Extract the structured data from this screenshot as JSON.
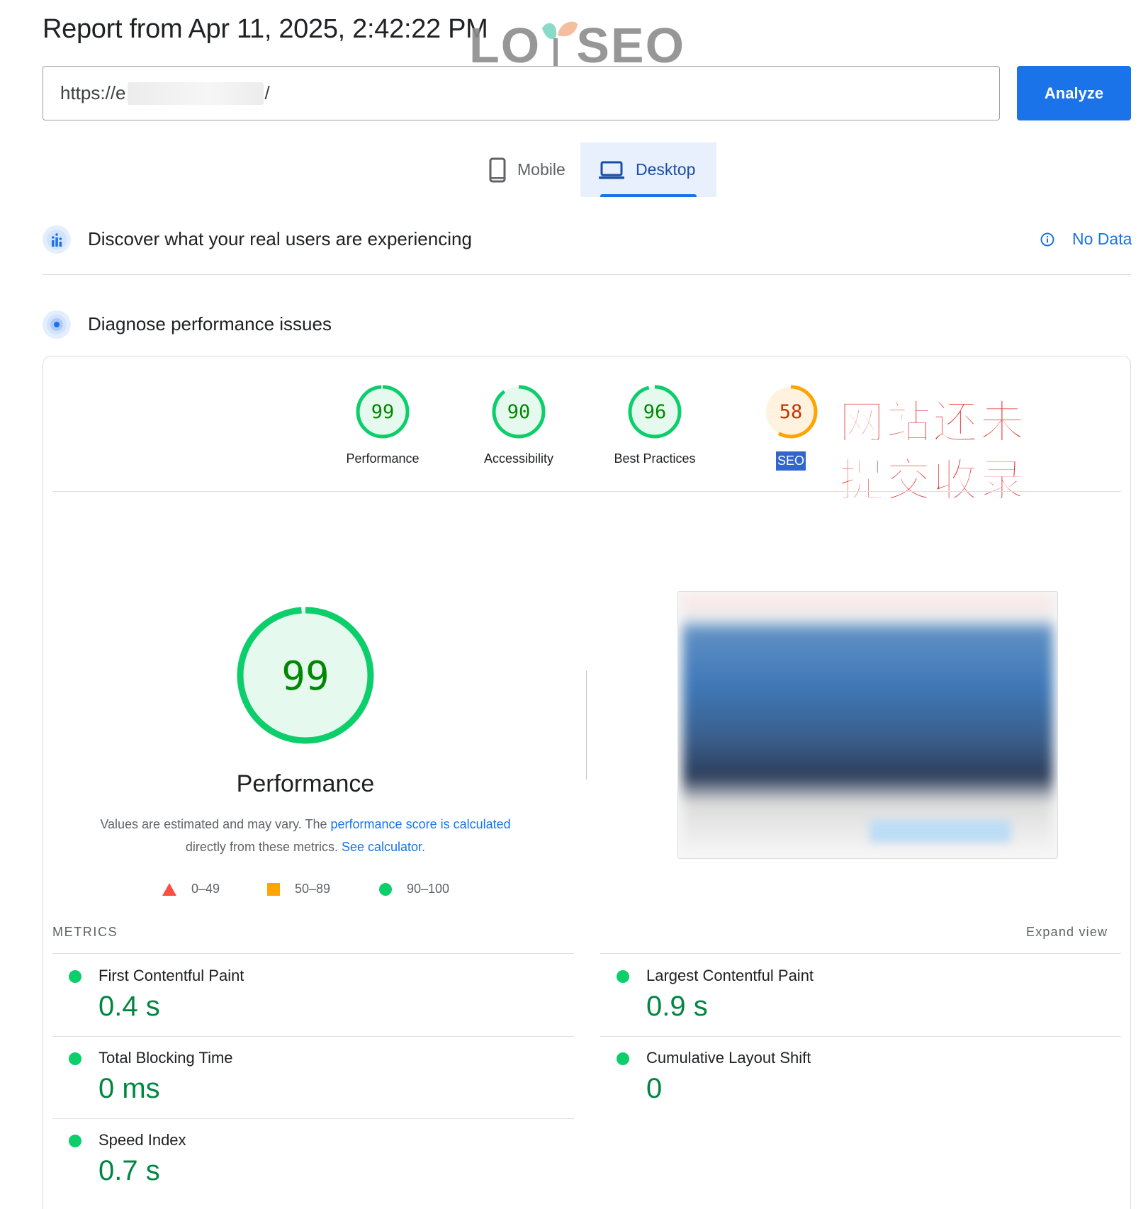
{
  "header": {
    "title": "Report from Apr 11, 2025, 2:42:22 PM",
    "watermark_left": "LO",
    "watermark_right": "SEO"
  },
  "search": {
    "url_prefix": "https://e",
    "url_suffix": "/",
    "analyze_label": "Analyze"
  },
  "tabs": [
    {
      "label": "Mobile",
      "icon": "smartphone-icon",
      "active": false
    },
    {
      "label": "Desktop",
      "icon": "laptop-icon",
      "active": true
    }
  ],
  "real_users": {
    "title": "Discover what your real users are experiencing",
    "status": "No Data",
    "icon": "crux-chart-icon"
  },
  "diagnose": {
    "title": "Diagnose performance issues",
    "icon": "lighthouse-icon"
  },
  "scores": [
    {
      "label": "Performance",
      "value": 99,
      "color": "#0cce6b",
      "text_color": "#008800"
    },
    {
      "label": "Accessibility",
      "value": 90,
      "color": "#0cce6b",
      "text_color": "#008800"
    },
    {
      "label": "Best Practices",
      "value": 96,
      "color": "#0cce6b",
      "text_color": "#008800"
    },
    {
      "label": "SEO",
      "value": 58,
      "color": "#ffa400",
      "text_color": "#c33300"
    }
  ],
  "annotation": {
    "line1": "网站还未",
    "line2": "提交收录"
  },
  "performance": {
    "score": 99,
    "title": "Performance",
    "desc_prefix": "Values are estimated and may vary. The ",
    "desc_link1": "performance score is calculated",
    "desc_middle": "directly from these metrics. ",
    "desc_link2": "See calculator."
  },
  "legend": [
    {
      "range": "0–49",
      "shape": "triangle",
      "color": "#ff4e42"
    },
    {
      "range": "50–89",
      "shape": "square",
      "color": "#ffa400"
    },
    {
      "range": "90–100",
      "shape": "circle",
      "color": "#0cce6b"
    }
  ],
  "metrics": {
    "heading": "METRICS",
    "expand_label": "Expand view",
    "items": [
      {
        "name": "First Contentful Paint",
        "value": "0.4 s"
      },
      {
        "name": "Largest Contentful Paint",
        "value": "0.9 s"
      },
      {
        "name": "Total Blocking Time",
        "value": "0 ms"
      },
      {
        "name": "Cumulative Layout Shift",
        "value": "0"
      },
      {
        "name": "Speed Index",
        "value": "0.7 s"
      }
    ]
  },
  "colors": {
    "accent": "#1a73e8",
    "pass": "#0cce6b",
    "average": "#ffa400",
    "fail": "#ff4e42"
  }
}
